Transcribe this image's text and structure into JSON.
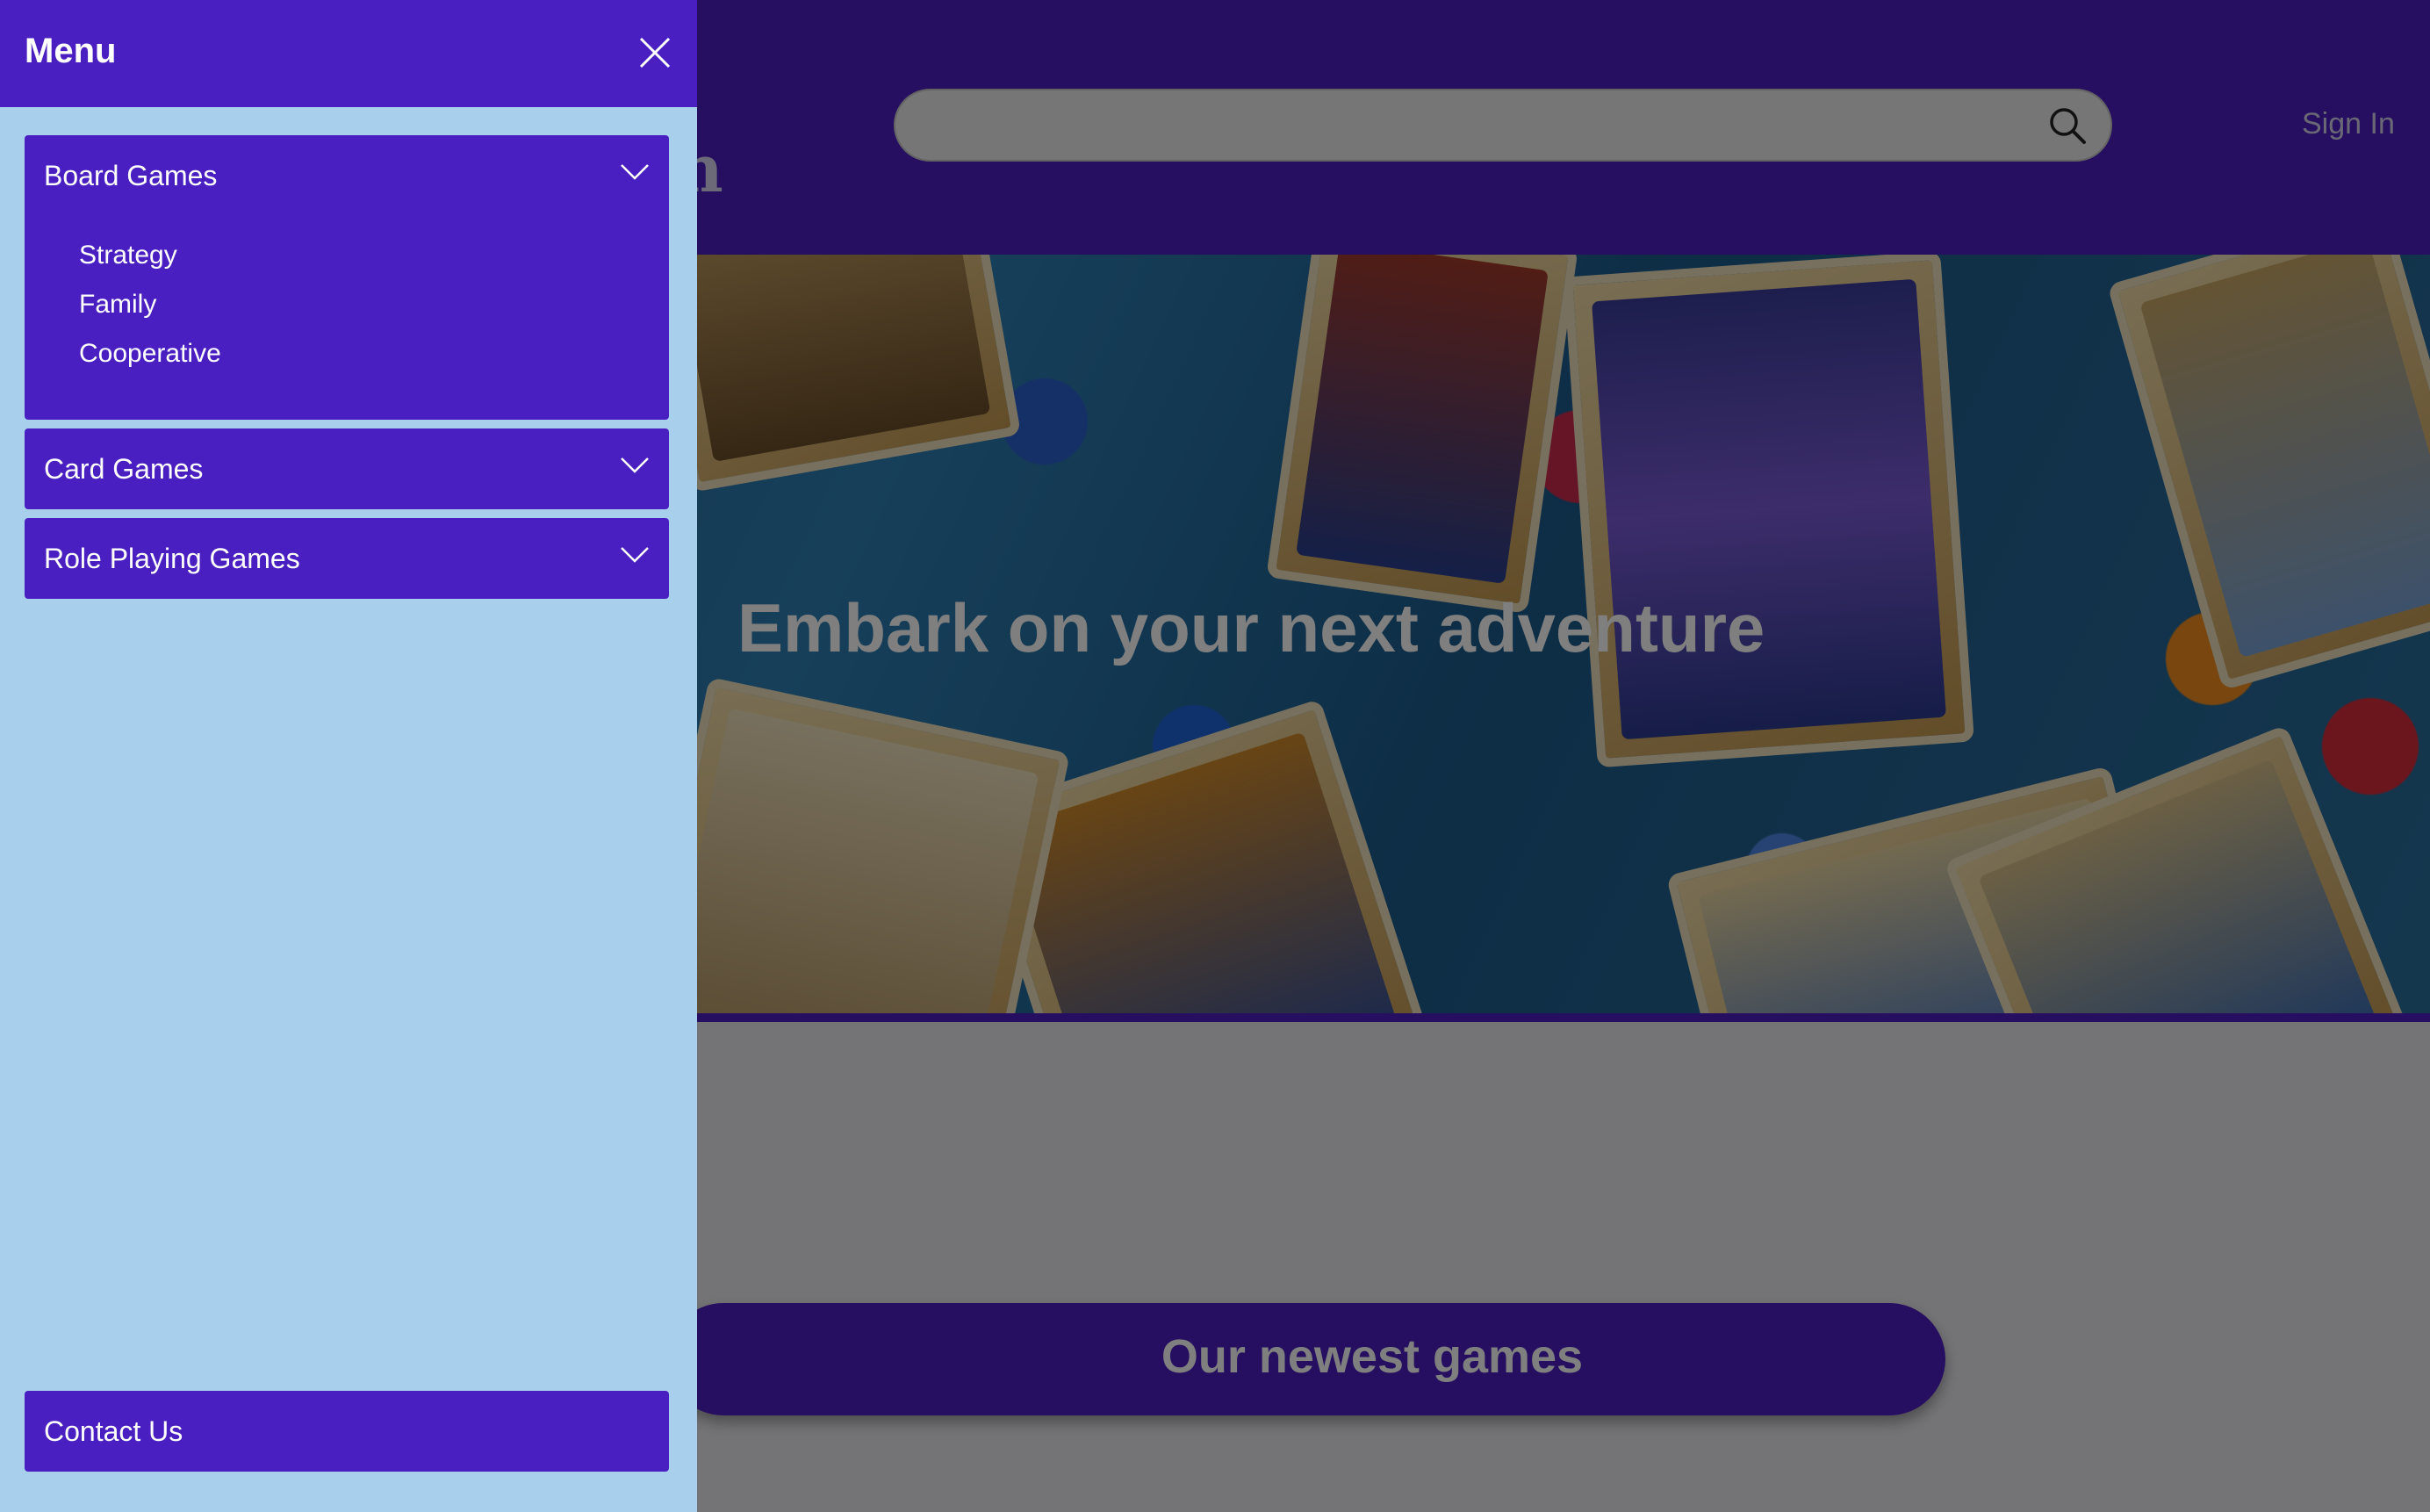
{
  "header": {
    "logo_glyph": "n",
    "search": {
      "placeholder": "",
      "value": ""
    },
    "sign_in_label": "Sign In"
  },
  "hero": {
    "title": "Embark on your next adventure"
  },
  "sections": {
    "newest_games_label": "Our newest games"
  },
  "menu": {
    "title": "Menu",
    "close_icon": "close-icon",
    "categories": [
      {
        "label": "Board Games",
        "expanded": true,
        "items": [
          "Strategy",
          "Family",
          "Cooperative"
        ]
      },
      {
        "label": "Card Games",
        "expanded": false,
        "items": []
      },
      {
        "label": "Role Playing Games",
        "expanded": false,
        "items": []
      }
    ],
    "contact_label": "Contact Us"
  },
  "colors": {
    "brand_purple": "#4a1fc2",
    "drawer_background": "#a8cfeb",
    "overlay": "rgba(0,0,0,0.5)",
    "text_light": "#ffffff"
  }
}
